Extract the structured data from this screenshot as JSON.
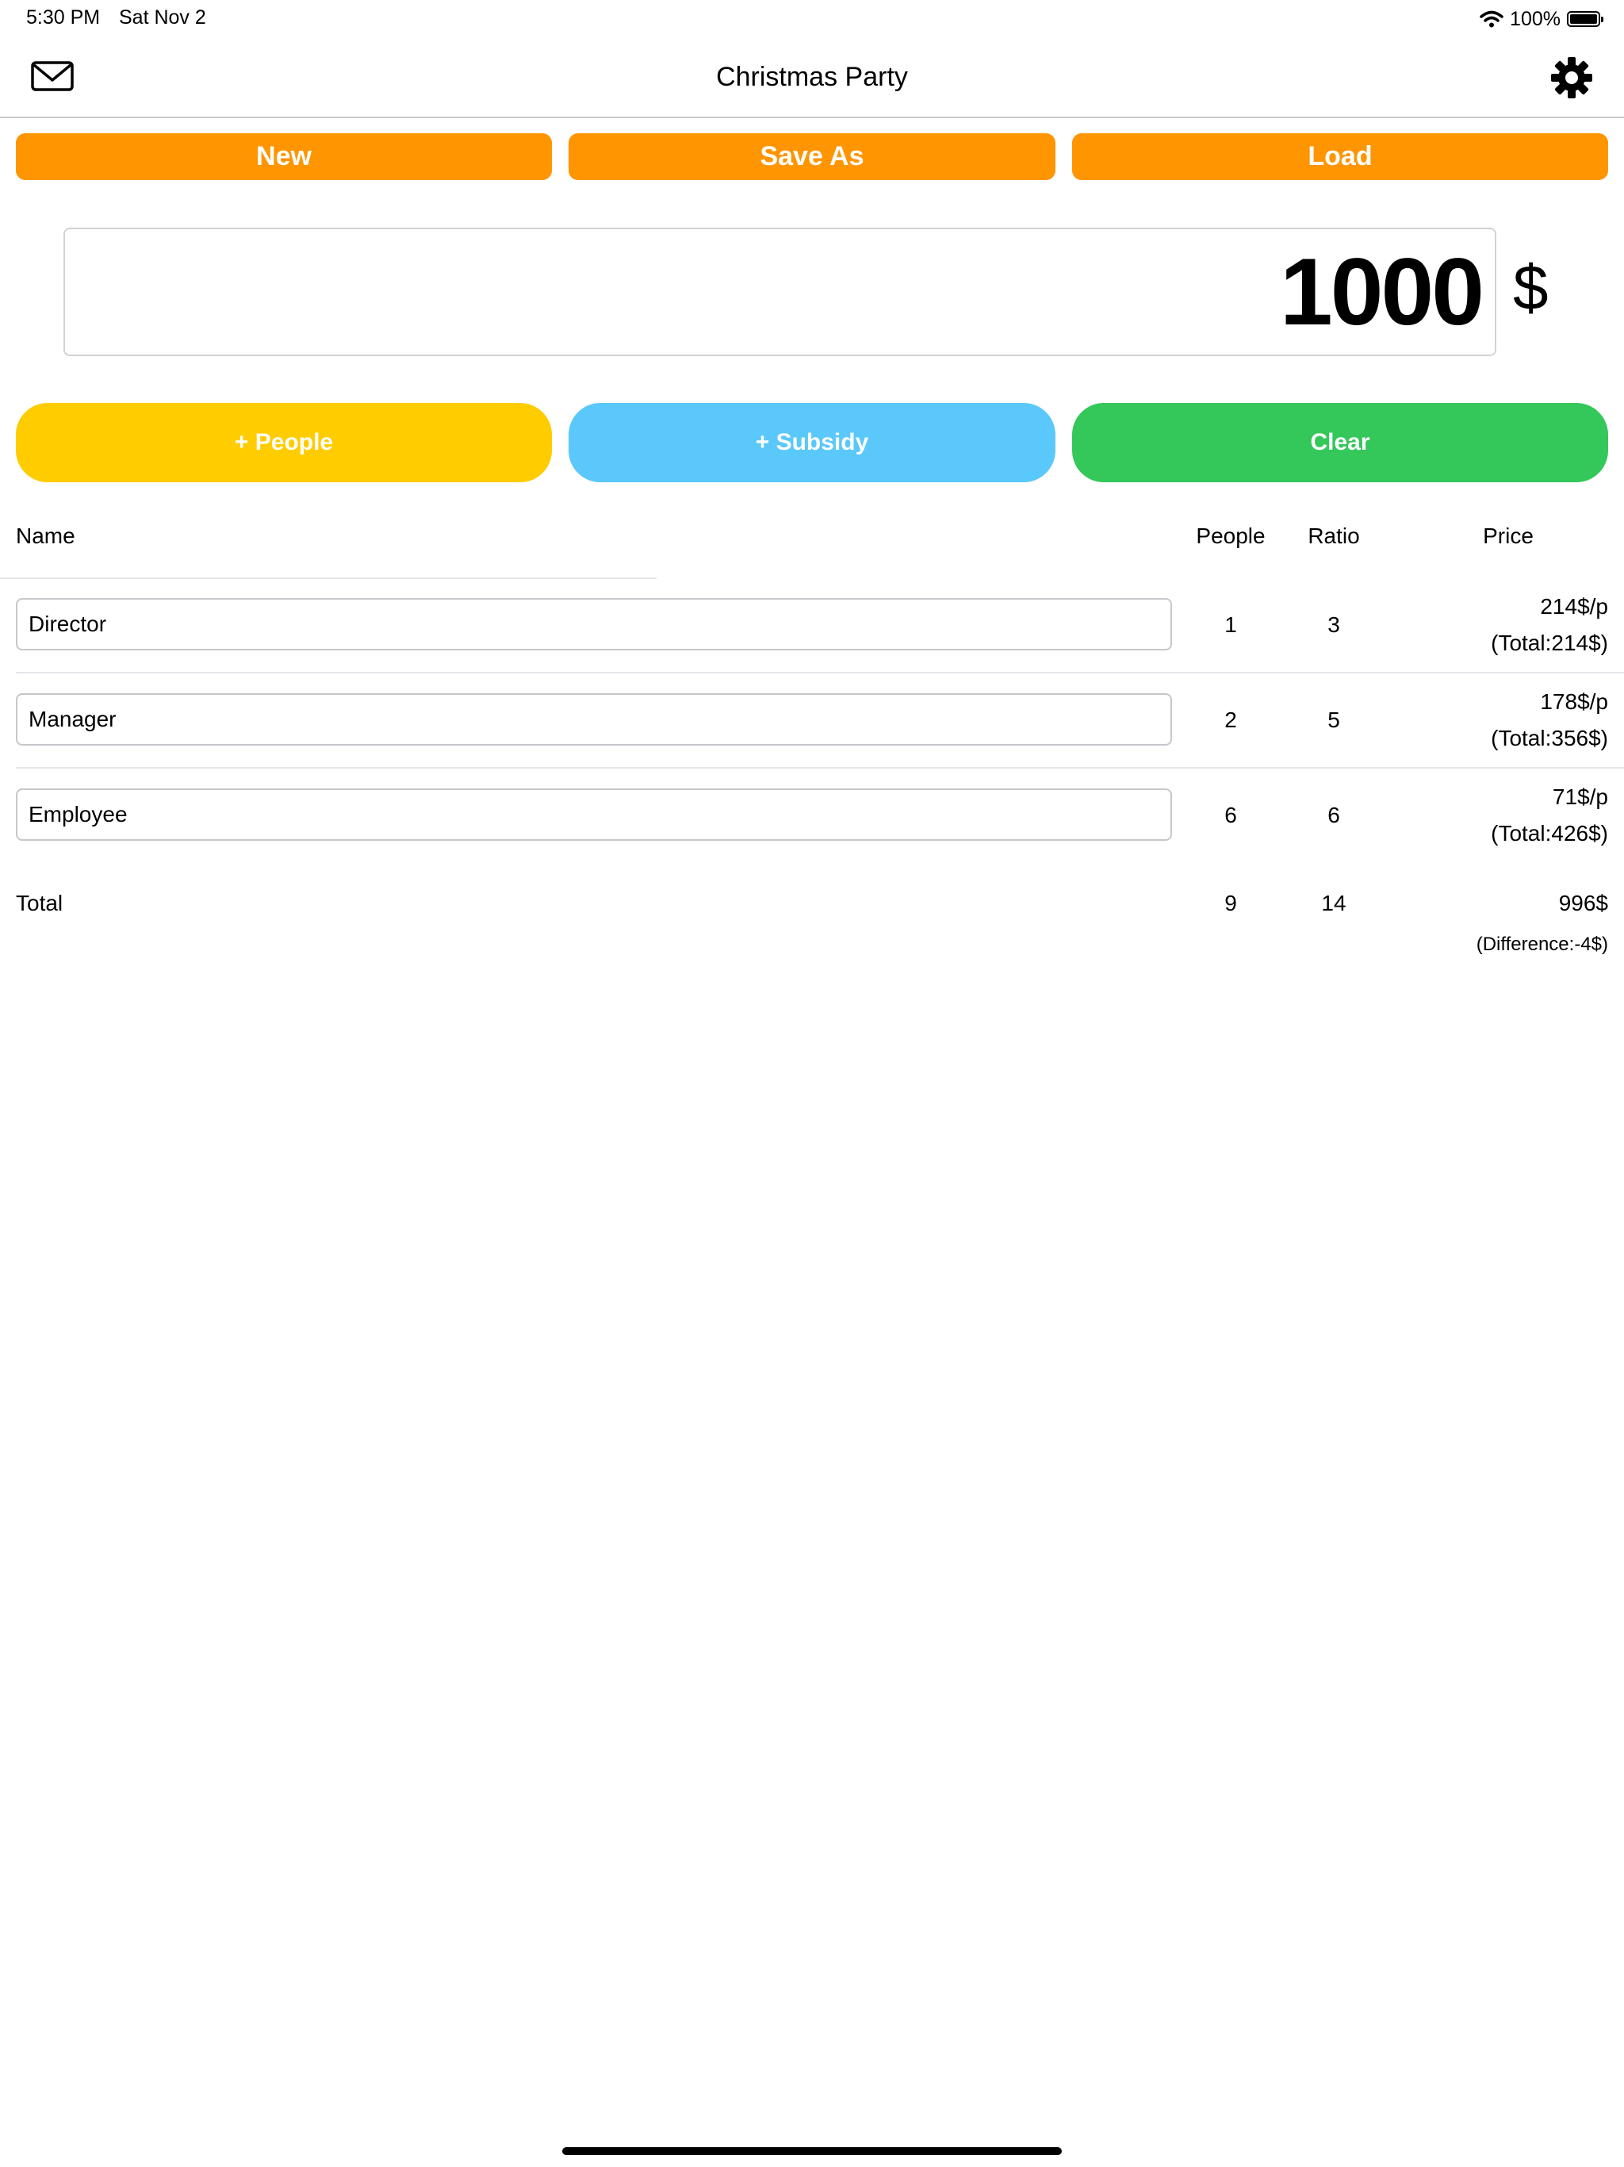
{
  "status_bar": {
    "time": "5:30 PM",
    "date": "Sat Nov 2",
    "battery": "100%",
    "battery_level": 1.0,
    "wifi_icon": "wifi-icon"
  },
  "nav": {
    "title": "Christmas Party",
    "left_icon": "mail-icon",
    "right_icon": "gear-icon"
  },
  "toolbar": {
    "new_label": "New",
    "save_as_label": "Save As",
    "load_label": "Load"
  },
  "amount": {
    "value": "1000",
    "unit": "$"
  },
  "actions": {
    "add_people_label": "+ People",
    "add_subsidy_label": "+ Subsidy",
    "clear_label": "Clear"
  },
  "table": {
    "headers": {
      "name": "Name",
      "people": "People",
      "ratio": "Ratio",
      "price": "Price"
    },
    "rows": [
      {
        "name": "Director",
        "people": "1",
        "ratio": "3",
        "price_per": "214$/p",
        "price_total": "(Total:214$)"
      },
      {
        "name": "Manager",
        "people": "2",
        "ratio": "5",
        "price_per": "178$/p",
        "price_total": "(Total:356$)"
      },
      {
        "name": "Employee",
        "people": "6",
        "ratio": "6",
        "price_per": "71$/p",
        "price_total": "(Total:426$)"
      }
    ],
    "total": {
      "label": "Total",
      "people": "9",
      "ratio": "14",
      "price": "996$",
      "difference": "(Difference:-4$)"
    }
  },
  "colors": {
    "orange": "#ff9500",
    "yellow": "#ffcc00",
    "blue": "#5ac8fa",
    "green": "#34c759"
  }
}
